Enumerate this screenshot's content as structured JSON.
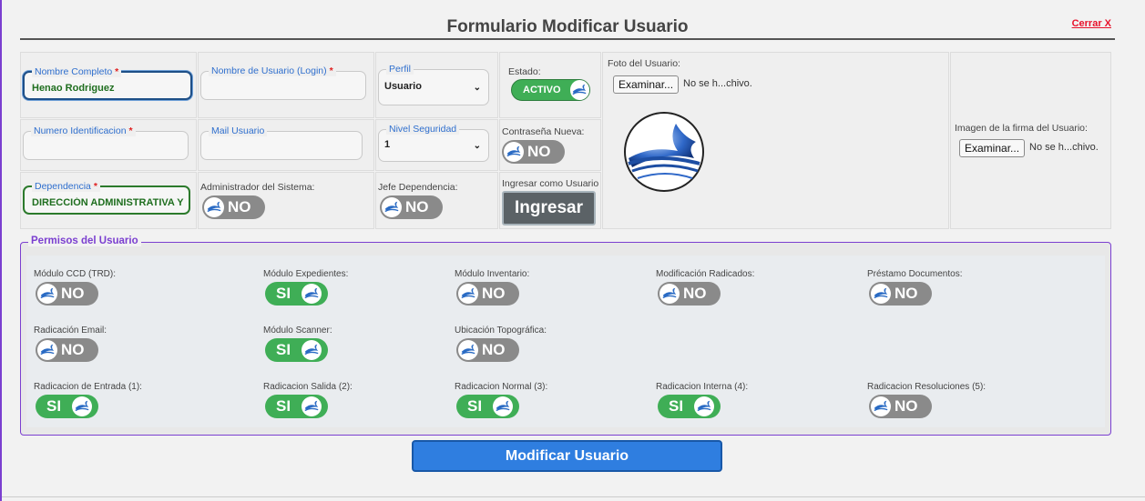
{
  "title": "Formulario Modificar Usuario",
  "close_label": "Cerrar X",
  "fields": {
    "nombre_completo": {
      "label": "Nombre Completo",
      "value": "Henao Rodriguez"
    },
    "nombre_usuario": {
      "label": "Nombre de Usuario (Login)",
      "value": ""
    },
    "perfil": {
      "label": "Perfil",
      "value": "Usuario"
    },
    "estado": {
      "label": "Estado:",
      "value": "ACTIVO"
    },
    "numero_identificacion": {
      "label": "Numero Identificacion",
      "value": ""
    },
    "mail_usuario": {
      "label": "Mail Usuario",
      "value": ""
    },
    "nivel_seguridad": {
      "label": "Nivel Seguridad",
      "value": "1"
    },
    "contrasena_nueva": {
      "label": "Contraseña Nueva:",
      "value": "NO"
    },
    "dependencia": {
      "label": "Dependencia",
      "value": "DIRECCIÓN ADMINISTRATIVA Y FIN"
    },
    "admin_sistema": {
      "label": "Administrador del Sistema:",
      "value": "NO"
    },
    "jefe_dependencia": {
      "label": "Jefe Dependencia:",
      "value": "NO"
    },
    "ingresar_como": {
      "label": "Ingresar como Usuario",
      "button": "Ingresar"
    },
    "required_mark": "*"
  },
  "foto": {
    "label": "Foto del Usuario:",
    "button": "Examinar...",
    "file_text": "No se h...chivo."
  },
  "firma": {
    "label": "Imagen de la firma del Usuario:",
    "button": "Examinar...",
    "file_text": "No se h...chivo."
  },
  "permisos": {
    "legend": "Permisos del Usuario",
    "items": [
      {
        "label": "Módulo CCD (TRD):",
        "value": "NO"
      },
      {
        "label": "Módulo Expedientes:",
        "value": "SI"
      },
      {
        "label": "Módulo Inventario:",
        "value": "NO"
      },
      {
        "label": "Modificación Radicados:",
        "value": "NO"
      },
      {
        "label": "Préstamo Documentos:",
        "value": "NO"
      },
      {
        "label": "Radicación Email:",
        "value": "NO"
      },
      {
        "label": "Módulo Scanner:",
        "value": "SI"
      },
      {
        "label": "Ubicación Topográfica:",
        "value": "NO"
      },
      {
        "label": "Radicacion de Entrada (1):",
        "value": "SI"
      },
      {
        "label": "Radicacion Salida (2):",
        "value": "SI"
      },
      {
        "label": "Radicacion Normal (3):",
        "value": "SI"
      },
      {
        "label": "Radicacion Interna (4):",
        "value": "SI"
      },
      {
        "label": "Radicacion Resoluciones (5):",
        "value": "NO"
      }
    ]
  },
  "submit_label": "Modificar Usuario",
  "colors": {
    "accent": "#7b3fd0",
    "toggle_on": "#3fae56",
    "toggle_off": "#8a8a8a",
    "submit": "#2f7ee0",
    "close": "#e8122b"
  }
}
